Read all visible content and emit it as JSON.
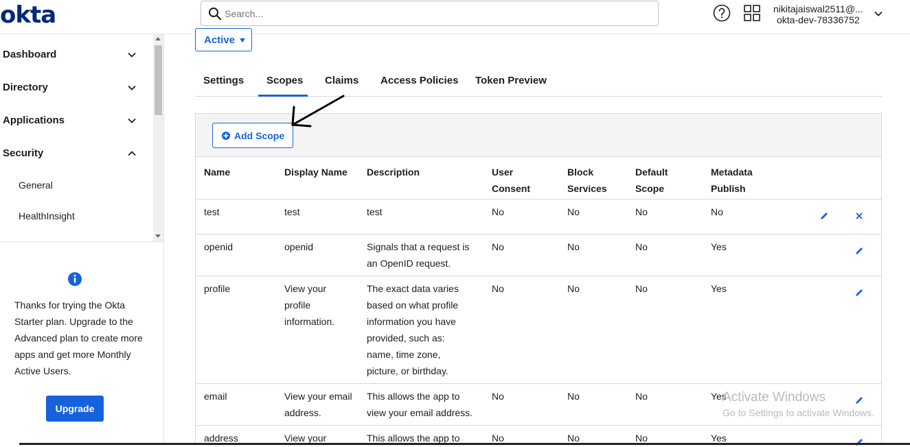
{
  "header": {
    "logo": "okta",
    "search_placeholder": "Search...",
    "user_name": "nikitajaiswal2511@...",
    "user_org": "okta-dev-78336752"
  },
  "sidebar": {
    "items": [
      {
        "label": "Dashboard"
      },
      {
        "label": "Directory"
      },
      {
        "label": "Applications"
      },
      {
        "label": "Security"
      }
    ],
    "sub_items": [
      {
        "label": "General"
      },
      {
        "label": "HealthInsight"
      }
    ],
    "promo_text": "Thanks for trying the Okta Starter plan. Upgrade to the Advanced plan to create more apps and get more Monthly Active Users.",
    "upgrade_label": "Upgrade"
  },
  "main": {
    "status": "Active",
    "tabs": [
      {
        "label": "Settings"
      },
      {
        "label": "Scopes",
        "active": true
      },
      {
        "label": "Claims"
      },
      {
        "label": "Access Policies"
      },
      {
        "label": "Token Preview"
      }
    ],
    "add_scope_label": "Add Scope",
    "columns": [
      "Name",
      "Display Name",
      "Description",
      "User\nConsent",
      "Block\nServices",
      "Default\nScope",
      "Metadata\nPublish"
    ],
    "rows": [
      {
        "name": "test",
        "display": "test",
        "desc": "test",
        "consent": "No",
        "block": "No",
        "default": "No",
        "publish": "No"
      },
      {
        "name": "openid",
        "display": "openid",
        "desc": "Signals that a request is an OpenID request.",
        "consent": "No",
        "block": "No",
        "default": "No",
        "publish": "Yes"
      },
      {
        "name": "profile",
        "display": "View your profile information.",
        "desc": "The exact data varies based on what profile information you have provided, such as: name, time zone, picture, or birthday.",
        "consent": "No",
        "block": "No",
        "default": "No",
        "publish": "Yes"
      },
      {
        "name": "email",
        "display": "View your email address.",
        "desc": "This allows the app to view your email address.",
        "consent": "No",
        "block": "No",
        "default": "No",
        "publish": "Yes"
      },
      {
        "name": "address",
        "display": "View your",
        "desc": "This allows the app to",
        "consent": "No",
        "block": "No",
        "default": "No",
        "publish": "Yes"
      }
    ]
  },
  "watermark": {
    "title": "Activate Windows",
    "subtitle": "Go to Settings to activate Windows."
  },
  "colors": {
    "accent": "#1662dd",
    "brand": "#00297a"
  }
}
